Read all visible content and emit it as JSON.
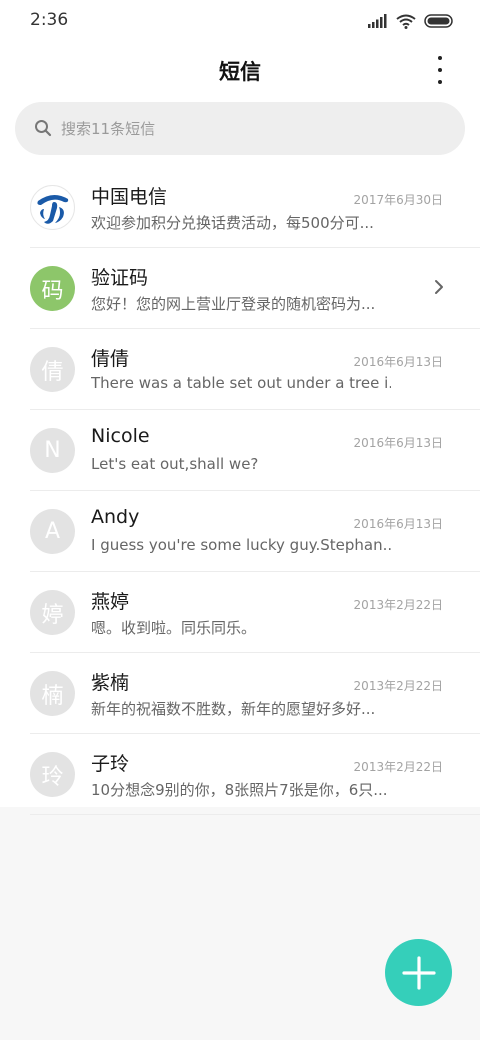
{
  "status_bar": {
    "time": "2:36",
    "icons": [
      "signal-icon",
      "wifi-icon",
      "battery-icon"
    ]
  },
  "header": {
    "title": "短信",
    "more_icon": "more-vertical-icon"
  },
  "search": {
    "placeholder": "搜索11条短信",
    "icon": "search-icon"
  },
  "conversations": [
    {
      "name": "中国电信",
      "preview": "欢迎参加积分兑换话费活动，每500分可...",
      "date": "2017年6月30日",
      "avatar": "",
      "avatar_type": "logo"
    },
    {
      "name": "验证码",
      "preview": "您好！您的网上营业厅登录的随机密码为...",
      "date": "",
      "avatar": "码",
      "avatar_type": "green"
    },
    {
      "name": "倩倩",
      "preview": "There was a table set out under a tree i...",
      "date": "2016年6月13日",
      "avatar": "倩",
      "avatar_type": "grey"
    },
    {
      "name": "Nicole",
      "preview": "Let's eat out,shall we?",
      "date": "2016年6月13日",
      "avatar": "N",
      "avatar_type": "grey"
    },
    {
      "name": "Andy",
      "preview": "I guess you're some lucky guy.Stephan...",
      "date": "2016年6月13日",
      "avatar": "A",
      "avatar_type": "grey"
    },
    {
      "name": "燕婷",
      "preview": "嗯。收到啦。同乐同乐。",
      "date": "2013年2月22日",
      "avatar": "婷",
      "avatar_type": "grey"
    },
    {
      "name": "紫楠",
      "preview": "新年的祝福数不胜数，新年的愿望好多好...",
      "date": "2013年2月22日",
      "avatar": "楠",
      "avatar_type": "grey"
    },
    {
      "name": "子玲",
      "preview": "10分想念9别的你，8张照片7张是你，6只...",
      "date": "2013年2月22日",
      "avatar": "玲",
      "avatar_type": "grey"
    }
  ],
  "colors": {
    "accent": "#35cfba",
    "avatar_green": "#8dc66a",
    "avatar_grey": "#e3e3e3",
    "telecom_blue": "#1a5aa8"
  },
  "fab": {
    "icon": "plus-icon"
  }
}
